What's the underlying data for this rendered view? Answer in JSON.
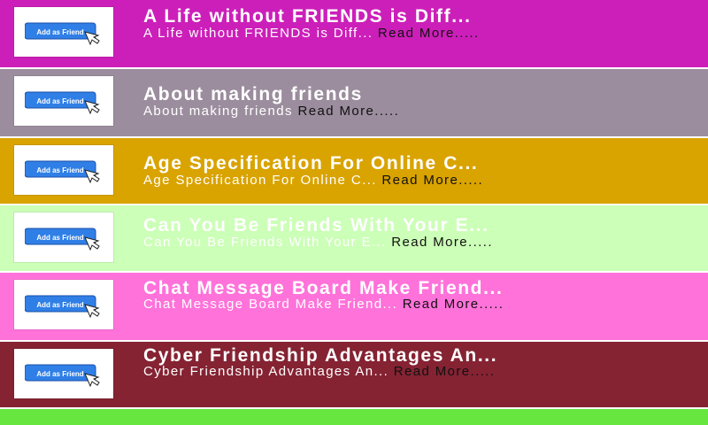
{
  "items": [
    {
      "title": "A Life without FRIENDS is Diff...",
      "desc": "A Life without FRIENDS is Diff...",
      "read_more": "Read More.....",
      "bg": "#cc1fb9",
      "text_color": "#ffffff"
    },
    {
      "title": "About making friends",
      "desc": "About making friends",
      "read_more": "Read More.....",
      "bg": "#9b8d9d",
      "text_color": "#ffffff"
    },
    {
      "title": "Age Specification For Online C...",
      "desc": "Age Specification For Online C...",
      "read_more": "Read More.....",
      "bg": "#d9a300",
      "text_color": "#ffffff"
    },
    {
      "title": "Can You Be Friends With Your E...",
      "desc": "Can You Be Friends With Your E...",
      "read_more": "Read More.....",
      "bg": "#ccffb7",
      "text_color": "#ffffff"
    },
    {
      "title": "Chat Message Board Make Friend...",
      "desc": "Chat Message Board Make Friend...",
      "read_more": "Read More.....",
      "bg": "#ff72da",
      "text_color": "#ffffff"
    },
    {
      "title": "Cyber Friendship Advantages An...",
      "desc": "Cyber Friendship Advantages An...",
      "read_more": "Read More.....",
      "bg": "#852333",
      "text_color": "#ffffff"
    }
  ],
  "thumbnail_label": "Add as Friend",
  "partial_row_color": "#66e63f",
  "icons": {
    "thumbnail": "add-friend-button-icon"
  }
}
